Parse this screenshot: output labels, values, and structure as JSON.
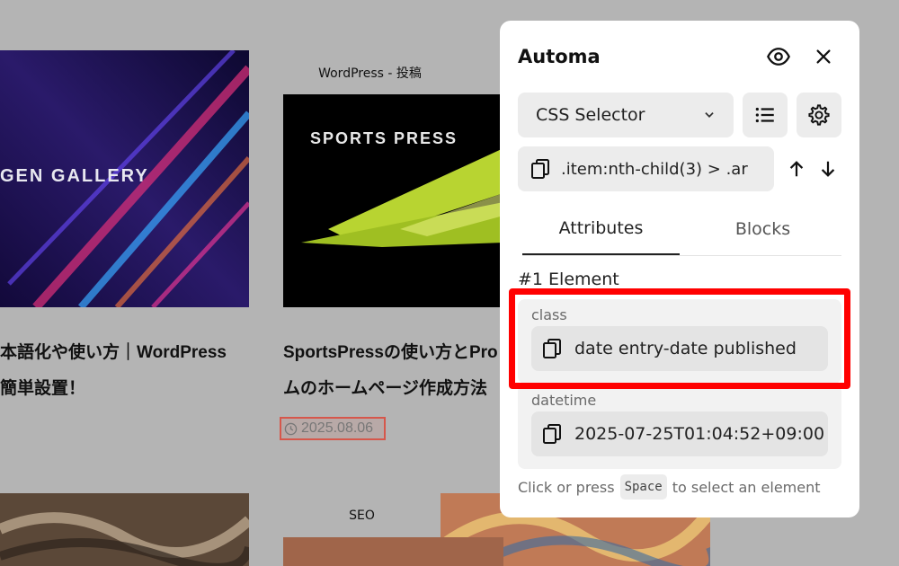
{
  "background": {
    "cards": [
      {
        "category": "",
        "title_lines": [
          "本語化や使い方｜WordPress",
          "簡単設置！"
        ],
        "thumb_text": "GEN GALLERY"
      },
      {
        "category": "WordPress - 投稿",
        "title_lines": [
          "SportsPressの使い方とPro",
          "ムのホームページ作成方法"
        ],
        "thumb_text": "SPORTS PRESS",
        "date": "2025.08.06"
      }
    ],
    "bottom_category": "SEO"
  },
  "panel": {
    "title": "Automa",
    "icons": {
      "visibility": "eye-icon",
      "close": "close-icon",
      "list": "list-icon",
      "settings": "gear-icon",
      "copy": "copy-icon",
      "up": "arrow-up-icon",
      "down": "arrow-down-icon"
    },
    "selector_type": "CSS Selector",
    "selector_value": ".item:nth-child(3) > .ar",
    "tabs": [
      {
        "label": "Attributes",
        "active": true
      },
      {
        "label": "Blocks",
        "active": false
      }
    ],
    "element_heading": "#1 Element",
    "attributes": [
      {
        "name": "class",
        "value": "date entry-date published"
      },
      {
        "name": "datetime",
        "value": "2025-07-25T01:04:52+09:00"
      }
    ],
    "hint": {
      "before": "Click or press",
      "key": "Space",
      "after": "to select an element"
    }
  },
  "colors": {
    "highlight": "#ff0000",
    "overlay": "#b4b4b4",
    "panel_bg": "#ffffff",
    "date_outline": "#d6574b"
  }
}
